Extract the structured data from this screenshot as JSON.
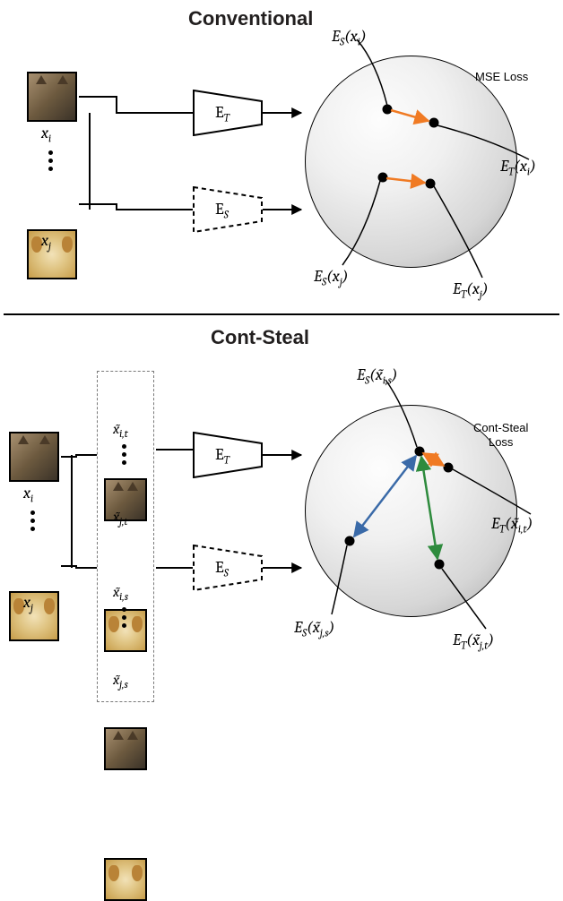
{
  "top": {
    "title": "Conventional",
    "loss_label": "MSE Loss",
    "inputs": {
      "xi": "x",
      "xi_sub": "i",
      "xj": "x",
      "xj_sub": "j"
    },
    "encoders": {
      "et": "E",
      "et_sub": "T",
      "es": "E",
      "es_sub": "S"
    },
    "annos": {
      "es_xi": "E",
      "es_xi_sub": "S",
      "es_xi_arg": "(x",
      "es_xi_argsub": "i",
      "es_xi_close": ")",
      "et_xi": "E",
      "et_xi_sub": "T",
      "et_xi_arg": "(x",
      "et_xi_argsub": "i",
      "et_xi_close": ")",
      "es_xj": "E",
      "es_xj_sub": "S",
      "es_xj_arg": "(x",
      "es_xj_argsub": "j",
      "es_xj_close": ")",
      "et_xj": "E",
      "et_xj_sub": "T",
      "et_xj_arg": "(x",
      "et_xj_argsub": "j",
      "et_xj_close": ")"
    }
  },
  "bottom": {
    "title": "Cont-Steal",
    "loss_label": "Cont-Steal\nLoss",
    "inputs": {
      "xi": "x",
      "xi_sub": "i",
      "xj": "x",
      "xj_sub": "j"
    },
    "aug": {
      "xit": "x̃",
      "xit_sub": "i,t",
      "xjt": "x̃",
      "xjt_sub": "j,t",
      "xis": "x̃",
      "xis_sub": "i,s",
      "xjs": "x̃",
      "xjs_sub": "j,s"
    },
    "encoders": {
      "et": "E",
      "et_sub": "T",
      "es": "E",
      "es_sub": "S"
    },
    "annos": {
      "es_xis": "E",
      "es_xis_sub": "S",
      "es_xis_arg": "(x̃",
      "es_xis_argsub": "i,s",
      "es_xis_close": ")",
      "et_xit": "E",
      "et_xit_sub": "T",
      "et_xit_arg": "(x̃",
      "et_xit_argsub": "i,t",
      "et_xit_close": ")",
      "es_xjs": "E",
      "es_xjs_sub": "S",
      "es_xjs_arg": "(x̃",
      "es_xjs_argsub": "j,s",
      "es_xjs_close": ")",
      "et_xjt": "E",
      "et_xjt_sub": "T",
      "et_xjt_arg": "(x̃",
      "et_xjt_argsub": "j,t",
      "et_xjt_close": ")"
    }
  },
  "colors": {
    "orange": "#f07a23",
    "blue": "#3a6aa8",
    "green": "#2e8b3d"
  }
}
